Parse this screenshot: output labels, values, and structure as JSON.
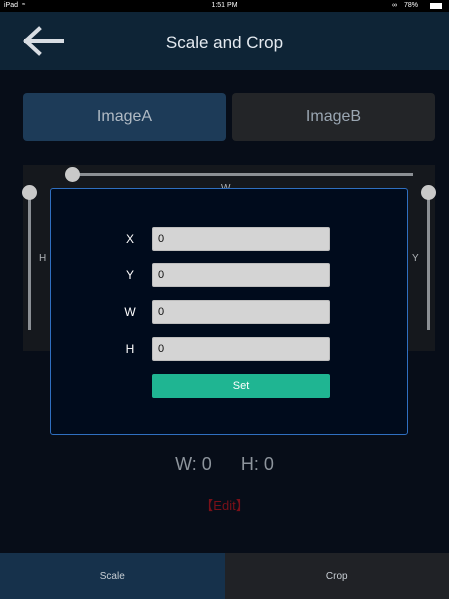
{
  "status": {
    "carrier": "iPad",
    "time": "1:51 PM",
    "battery": "78%"
  },
  "header": {
    "title": "Scale and Crop"
  },
  "tabs": {
    "image_a": "ImageA",
    "image_b": "ImageB"
  },
  "crop": {
    "top_label": "W",
    "left_label": "H",
    "right_label": "Y"
  },
  "dialog": {
    "fields": [
      {
        "label": "X",
        "value": "0"
      },
      {
        "label": "Y",
        "value": "0"
      },
      {
        "label": "W",
        "value": "0"
      },
      {
        "label": "H",
        "value": "0"
      }
    ],
    "set_label": "Set"
  },
  "info": {
    "width_text": "W: 0",
    "height_text": "H: 0"
  },
  "edit_label": "【Edit】",
  "bottom_tabs": {
    "scale": "Scale",
    "crop": "Crop"
  },
  "colors": {
    "accent": "#1fb592",
    "dialog_border": "#2f6fc0",
    "header_bg": "#0e2436"
  }
}
